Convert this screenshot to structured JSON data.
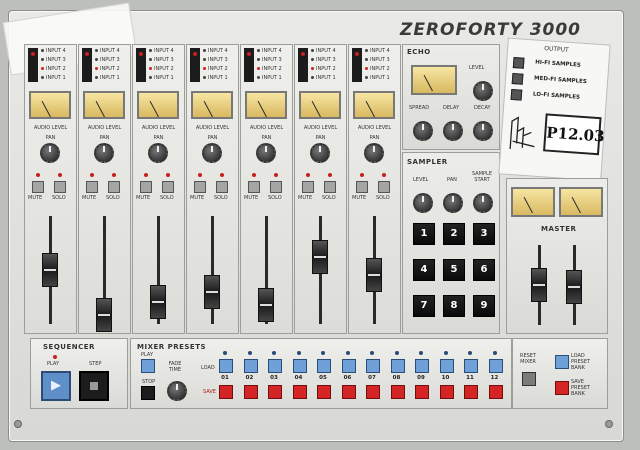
{
  "brand": "ZEROFORTY 3000",
  "channels": [
    {
      "inputs": [
        "INPUT 4",
        "INPUT 3",
        "INPUT 2",
        "INPUT 1"
      ],
      "pan_label": "PAN"
    },
    {
      "inputs": [
        "INPUT 4",
        "INPUT 3",
        "INPUT 2",
        "INPUT 1"
      ],
      "pan_label": "PAN"
    },
    {
      "inputs": [
        "INPUT 4",
        "INPUT 3",
        "INPUT 2",
        "INPUT 1"
      ],
      "pan_label": "PAN"
    },
    {
      "inputs": [
        "INPUT 4",
        "INPUT 3",
        "INPUT 2",
        "INPUT 1"
      ],
      "pan_label": "PAN"
    },
    {
      "inputs": [
        "INPUT 4",
        "INPUT 3",
        "INPUT 2",
        "INPUT 1"
      ],
      "pan_label": "PAN"
    },
    {
      "inputs": [
        "INPUT 4",
        "INPUT 3",
        "INPUT 2",
        "INPUT 1"
      ],
      "pan_label": "PAN"
    },
    {
      "inputs": [
        "INPUT 4",
        "INPUT 3",
        "INPUT 2",
        "INPUT 1"
      ],
      "pan_label": "PAN"
    }
  ],
  "channel_labels": {
    "audio_level": "AUDIO LEVEL",
    "mute": "MUTE",
    "solo": "SOLO"
  },
  "channel_fader_levels": [
    0.5,
    0.08,
    0.2,
    0.3,
    0.18,
    0.62,
    0.45
  ],
  "echo": {
    "title": "ECHO",
    "level": "LEVEL",
    "spread": "SPREAD",
    "delay": "DELAY",
    "decay": "DECAY"
  },
  "sampler": {
    "title": "SAMPLER",
    "level": "LEVEL",
    "pan": "PAN",
    "sample_start": "SAMPLE START",
    "pads": [
      "1",
      "2",
      "3",
      "4",
      "5",
      "6",
      "7",
      "8",
      "9"
    ]
  },
  "output": {
    "title": "OUTPUT",
    "options": [
      "HI-FI SAMPLES",
      "MED-FI SAMPLES",
      "LO-FI SAMPLES"
    ],
    "sticker": "P12.03"
  },
  "master": {
    "title": "MASTER",
    "fader_levels": [
      0.5,
      0.48
    ]
  },
  "sequencer": {
    "title": "SEQUENCER",
    "play": "PLAY",
    "step": "STEP"
  },
  "mixer_presets": {
    "title": "MIXER PRESETS",
    "play": "PLAY",
    "stop": "STOP",
    "fade_time": "FADE TIME",
    "load": "LOAD",
    "save": "SAVE",
    "numbers": [
      "01",
      "02",
      "03",
      "04",
      "05",
      "06",
      "07",
      "08",
      "09",
      "10",
      "11",
      "12"
    ]
  },
  "right_controls": {
    "reset_mixer": "RESET MIXER",
    "load_preset_bank": "LOAD PRESET BANK",
    "save_preset_bank": "SAVE PRESET BANK"
  },
  "colors": {
    "accent_blue": "#6fa1d8",
    "save_red": "#d42424",
    "vu": "#e8d48a"
  }
}
